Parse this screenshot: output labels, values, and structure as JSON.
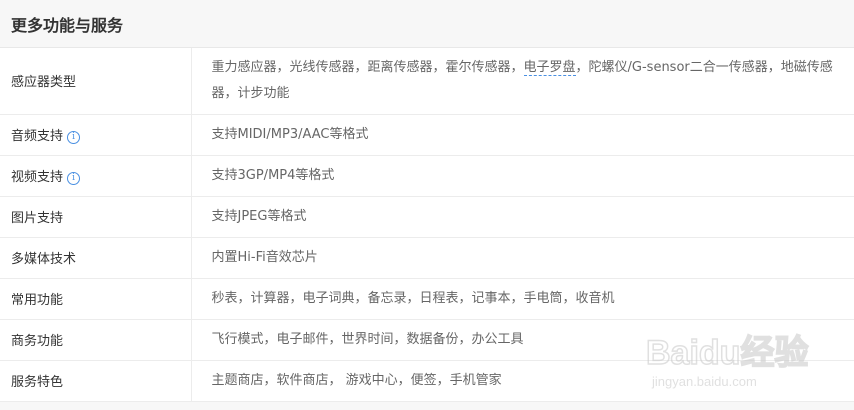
{
  "header": {
    "title": "更多功能与服务"
  },
  "rows": [
    {
      "label": "感应器类型",
      "value_before": "重力感应器，光线传感器，距离传感器，霍尔传感器，",
      "value_link": "电子罗盘",
      "value_after": "，陀螺仪/G-sensor二合一传感器，地磁传感器，计步功能"
    },
    {
      "label": "音频支持",
      "value": "支持MIDI/MP3/AAC等格式",
      "info_icon": "info-circle-icon"
    },
    {
      "label": "视频支持",
      "value": "支持3GP/MP4等格式",
      "info_icon": "info-circle-icon"
    },
    {
      "label": "图片支持",
      "value": "支持JPEG等格式"
    },
    {
      "label": "多媒体技术",
      "value": "内置Hi-Fi音效芯片"
    },
    {
      "label": "常用功能",
      "value": "秒表，计算器，电子词典，备忘录，日程表，记事本，手电筒，收音机"
    },
    {
      "label": "商务功能",
      "value": "飞行模式，电子邮件，世界时间，数据备份，办公工具"
    },
    {
      "label": "服务特色",
      "value": "主题商店，软件商店， 游戏中心，便签，手机管家"
    }
  ],
  "watermark": {
    "logo": "Baidu经验",
    "url_text": "jingyan.baidu.com"
  },
  "colors": {
    "accent": "#4a90e2",
    "header_bg": "#f7f7f7",
    "border": "#ececec"
  }
}
